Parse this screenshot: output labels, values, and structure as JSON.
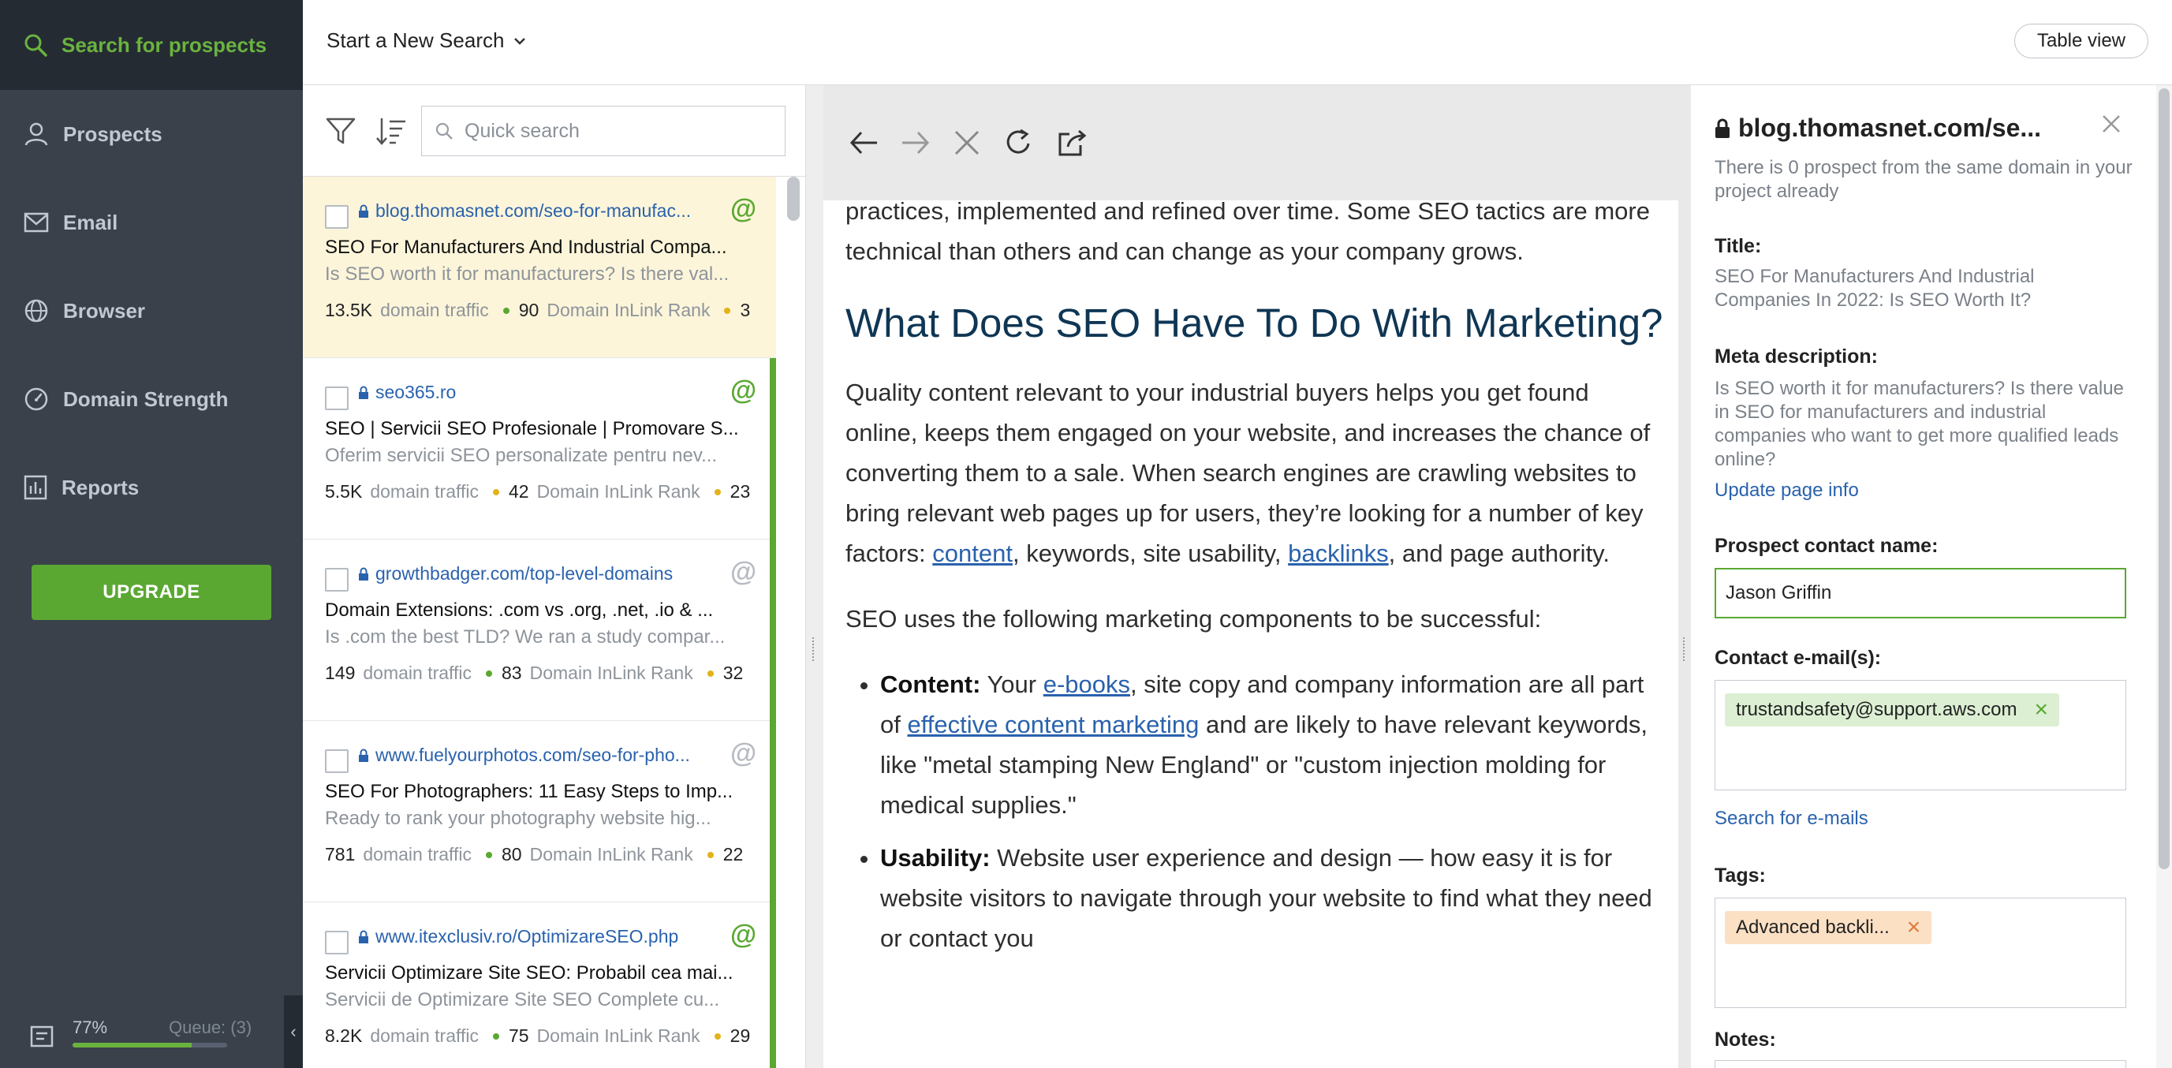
{
  "sidebar": {
    "search_label": "Search for prospects",
    "items": [
      {
        "label": "Prospects"
      },
      {
        "label": "Email"
      },
      {
        "label": "Browser"
      },
      {
        "label": "Domain Strength"
      },
      {
        "label": "Reports"
      }
    ],
    "upgrade_label": "UPGRADE",
    "progress_text": "77%",
    "progress_value": 0.77,
    "queue_text": "Queue: (3)"
  },
  "header": {
    "new_search_label": "Start a New Search",
    "table_view_label": "Table view"
  },
  "list": {
    "quick_search_placeholder": "Quick search",
    "prospects": [
      {
        "url": "blog.thomasnet.com/seo-for-manufac...",
        "title": "SEO For Manufacturers And Industrial Compa...",
        "desc": "Is SEO worth it for manufacturers? Is there val...",
        "traffic": "13.5K",
        "traffic_label": "domain traffic",
        "inlink": "90",
        "inlink_label": "Domain InLink Rank",
        "extra": "3"
      },
      {
        "url": "seo365.ro",
        "title": "SEO | Servicii SEO Profesionale | Promovare S...",
        "desc": "Oferim servicii SEO personalizate pentru nev...",
        "traffic": "5.5K",
        "traffic_label": "domain traffic",
        "inlink": "42",
        "inlink_label": "Domain InLink Rank",
        "extra": "23"
      },
      {
        "url": "growthbadger.com/top-level-domains",
        "title": "Domain Extensions: .com vs .org, .net, .io & ...",
        "desc": "Is .com the best TLD? We ran a study compar...",
        "traffic": "149",
        "traffic_label": "domain traffic",
        "inlink": "83",
        "inlink_label": "Domain InLink Rank",
        "extra": "32"
      },
      {
        "url": "www.fuelyourphotos.com/seo-for-pho...",
        "title": "SEO For Photographers: 11 Easy Steps to Imp...",
        "desc": "Ready to rank your photography website hig...",
        "traffic": "781",
        "traffic_label": "domain traffic",
        "inlink": "80",
        "inlink_label": "Domain InLink Rank",
        "extra": "22"
      },
      {
        "url": "www.itexclusiv.ro/OptimizareSEO.php",
        "title": "Servicii Optimizare Site SEO: Probabil cea mai...",
        "desc": "Servicii de Optimizare Site SEO Complete cu...",
        "traffic": "8.2K",
        "traffic_label": "domain traffic",
        "inlink": "75",
        "inlink_label": "Domain InLink Rank",
        "extra": "29"
      }
    ]
  },
  "article": {
    "p0": "practices, implemented and refined over time. Some SEO tactics are more technical than others and can change as your company grows.",
    "heading": "What Does SEO Have To Do With Marketing?",
    "p1_a": "Quality content relevant to your industrial buyers helps you get found online, keeps them engaged on your website, and increases the chance of converting them to a sale. When search engines are crawling websites to bring relevant web pages up for users, they’re looking for a number of key factors: ",
    "p1_link1": "content",
    "p1_b": ", keywords, site usability, ",
    "p1_link2": "backlinks",
    "p1_c": ", and page authority.",
    "p2": "SEO uses the following marketing components to be successful:",
    "li1_bold": "Content:",
    "li1_a": " Your ",
    "li1_link1": "e-books",
    "li1_b": ", site copy and company information are all part of ",
    "li1_link2": "effective content marketing",
    "li1_c": " and are likely to have relevant keywords, like \"metal stamping New England\" or \"custom injection molding for medical supplies.\"",
    "li2_bold": "Usability:",
    "li2_text": " Website user experience and design — how easy it is for website visitors to navigate through your website to find what they need or contact you"
  },
  "details": {
    "domain": "blog.thomasnet.com/se...",
    "note": "There is 0 prospect from the same domain in your project already",
    "title_label": "Title:",
    "title_value": "SEO For Manufacturers And Industrial Companies In 2022: Is SEO Worth It?",
    "meta_label": "Meta description:",
    "meta_value": "Is SEO worth it for manufacturers? Is there value in SEO for manufacturers and industrial companies who want to get more qualified leads online?",
    "update_link": "Update page info",
    "contact_label": "Prospect contact name:",
    "contact_value": "Jason Griffin",
    "email_label": "Contact e-mail(s):",
    "email_chip": "trustandsafety@support.aws.com",
    "search_emails": "Search for e-mails",
    "tags_label": "Tags:",
    "tag_chip": "Advanced backli...",
    "notes_label": "Notes:"
  },
  "colors": {
    "accent_green": "#5aa832",
    "sidebar_bg": "#3a414b",
    "link_blue": "#2a62ad",
    "selected_row": "#fdf5da"
  }
}
